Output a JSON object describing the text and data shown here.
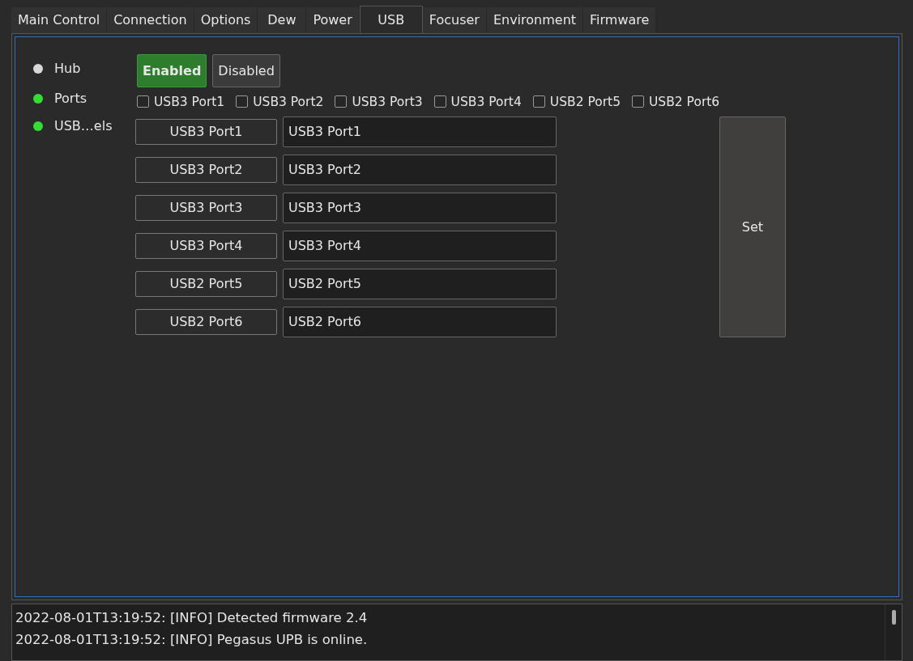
{
  "tabs": [
    {
      "label": "Main Control",
      "selected": false
    },
    {
      "label": "Connection",
      "selected": false
    },
    {
      "label": "Options",
      "selected": false
    },
    {
      "label": "Dew",
      "selected": false
    },
    {
      "label": "Power",
      "selected": false
    },
    {
      "label": "USB",
      "selected": true
    },
    {
      "label": "Focuser",
      "selected": false
    },
    {
      "label": "Environment",
      "selected": false
    },
    {
      "label": "Firmware",
      "selected": false
    }
  ],
  "hub": {
    "label": "Hub",
    "color": "#d8d8d8",
    "buttons": [
      {
        "label": "Enabled",
        "selected": true
      },
      {
        "label": "Disabled",
        "selected": false
      }
    ]
  },
  "ports": {
    "label": "Ports",
    "color": "#33dd33",
    "checkboxes": [
      {
        "label": "USB3 Port1",
        "checked": false
      },
      {
        "label": "USB3 Port2",
        "checked": false
      },
      {
        "label": "USB3 Port3",
        "checked": false
      },
      {
        "label": "USB3 Port4",
        "checked": false
      },
      {
        "label": "USB2 Port5",
        "checked": false
      },
      {
        "label": "USB2 Port6",
        "checked": false
      }
    ]
  },
  "labels": {
    "label": "USB…els",
    "color": "#33dd33",
    "rows": [
      {
        "name": "USB3 Port1",
        "value": "USB3 Port1"
      },
      {
        "name": "USB3 Port2",
        "value": "USB3 Port2"
      },
      {
        "name": "USB3 Port3",
        "value": "USB3 Port3"
      },
      {
        "name": "USB3 Port4",
        "value": "USB3 Port4"
      },
      {
        "name": "USB2 Port5",
        "value": "USB2 Port5"
      },
      {
        "name": "USB2 Port6",
        "value": "USB2 Port6"
      }
    ],
    "set_button": "Set"
  },
  "log": [
    "2022-08-01T13:19:52: [INFO] Detected firmware 2.4",
    "2022-08-01T13:19:52: [INFO] Pegasus UPB is online."
  ]
}
